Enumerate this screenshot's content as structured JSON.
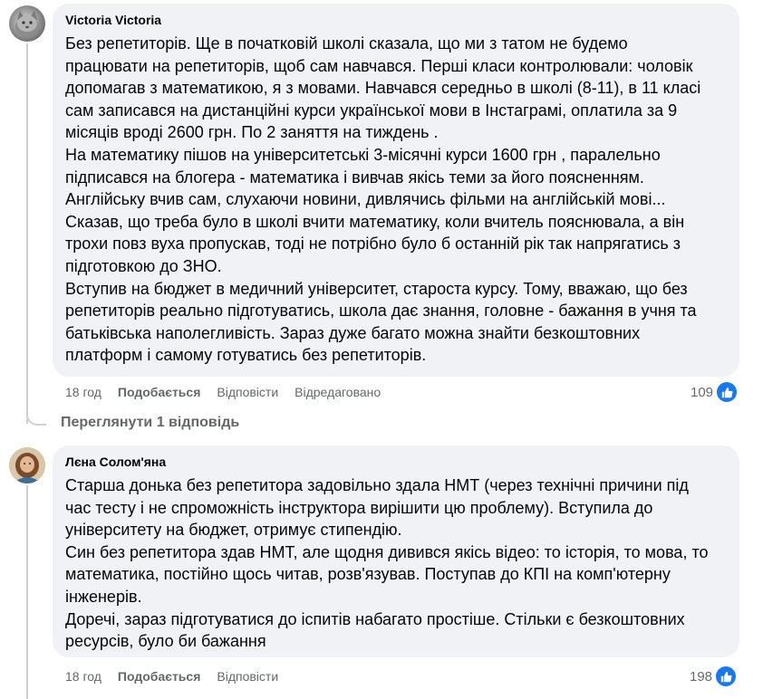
{
  "comments": [
    {
      "author": "Victoria Victoria",
      "lines": [
        "Без репетиторів. Ще в початковій школі сказала, що ми з татом не будемо",
        "працювати на репетиторів, щоб сам навчався. Перші класи контролювали: чоловік",
        "допомагав з математикою, я з мовами. Навчався середньо в школі (8-11), в 11 класі",
        "сам записався на дистанційні курси української мови в Інстаграмі, оплатила за 9",
        "місяців вроді 2600 грн. По 2 заняття на тиждень .",
        "На математику пішов на університетські 3-місячні курси 1600 грн , паралельно",
        "підписався на блогера - математика і вивчав якісь теми за його поясненням.",
        "Англійську вчив сам, слухаючи новини, дивлячись фільми на англійській мові...",
        "Сказав, що треба було в школі вчити математику, коли вчитель пояснювала, а він",
        "трохи повз вуха пропускав, тоді не потрібно було б останній рік так напрягатись з",
        "підготовкою до ЗНО.",
        "Вступив на бюджет в медичний університет, староста курсу. Тому, вважаю, що без",
        "репетиторів реально підготуватись, школа дає знання, головне - бажання в учня та",
        "батьківська наполегливість. Зараз дуже багато можна знайти безкоштовних",
        "платформ і самому готуватись без репетиторів."
      ],
      "time": "18 год",
      "like_label": "Подобається",
      "reply_label": "Відповісти",
      "edited_label": "Відредаговано",
      "reaction_count": "109",
      "reaction_icon": "thumbs-up-icon"
    },
    {
      "author": "Лєна Солом'яна",
      "lines": [
        "Старша донька без репетитора задовільно здала НМТ (через технічні причини під",
        "час тесту і не спроможність інструктора вирішити цю проблему). Вступила до",
        "університету на бюджет, отримує стипендію.",
        "Син без репетитора здав НМТ, але щодня дивився якісь відео: то історія, то мова, то",
        "математика, постійно щось читав, розв'язував. Поступав до КПІ на комп'ютерну",
        "інженерів.",
        "Доречі, зараз підготуватися до іспитів набагато простіше. Стільки є безкоштовних",
        "ресурсів, було би бажання"
      ],
      "time": "18 год",
      "like_label": "Подобається",
      "reply_label": "Відповісти",
      "reaction_count": "198",
      "reaction_icon": "thumbs-up-icon"
    }
  ],
  "view_replies_label": "Переглянути 1 відповідь",
  "colors": {
    "bubble": "#f0f2f5",
    "meta_text": "#65676b",
    "like_blue": "#1877f2",
    "thread_line": "#ced0d4"
  }
}
